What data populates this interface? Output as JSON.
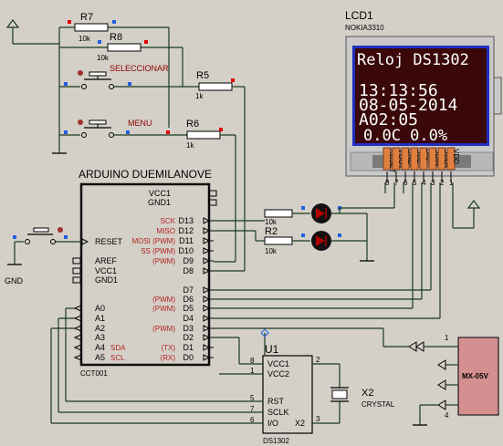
{
  "components": {
    "r7": {
      "ref": "R7",
      "value": "10k"
    },
    "r8": {
      "ref": "R8",
      "value": "10k"
    },
    "r5": {
      "ref": "R5",
      "value": "1k"
    },
    "r6": {
      "ref": "R6",
      "value": "1k"
    },
    "r1": {
      "ref": "",
      "value": "10k"
    },
    "r2": {
      "ref": "R2",
      "value": "10k"
    },
    "btn_select": "SELECCIONAR",
    "btn_menu": "MENU",
    "gnd": "GND",
    "x2": {
      "ref": "X2",
      "value": "CRYSTAL"
    },
    "u1": {
      "ref": "U1",
      "part": "DS1302"
    },
    "mx": "MX-05V"
  },
  "arduino": {
    "title": "ARDUINO DUEMILANOVE",
    "part": "CCT001",
    "left_pins": [
      "VCC1",
      "GND1",
      "RESET",
      "AREF",
      "VCC1",
      "GND1",
      "A0",
      "A1",
      "A2",
      "A3",
      "A4 SDA",
      "A5 SCL"
    ],
    "right_labels": [
      "VCC1",
      "GND1",
      "SCK",
      "MISO",
      "MOSI (PWM)",
      "SS (PWM)",
      "(PWM)",
      "",
      "",
      "(PWM)",
      "(PWM)",
      "",
      "(PWM)",
      "",
      "(TX)",
      "(RX)"
    ],
    "right_pins": [
      "",
      "",
      "D13",
      "D12",
      "D11",
      "D10",
      "D9",
      "D8",
      "D7",
      "D6",
      "D5",
      "D4",
      "D3",
      "D2",
      "D1",
      "D0"
    ]
  },
  "lcd": {
    "title": "LCD1",
    "model": "NOKIA3310",
    "line1": "Reloj DS1302",
    "line2": "13:13:56",
    "line3": "08-05-2014",
    "line4": "A02:05",
    "line5": "0.0C  0.0%",
    "pins": [
      "RESET",
      "VOUT",
      "GND",
      "SCE",
      "D/C",
      "SDIN",
      "SCLK",
      "VDD"
    ],
    "pin_numbers": [
      "8",
      "7",
      "6",
      "5",
      "4",
      "3",
      "2",
      "1"
    ]
  },
  "ds1302": {
    "pins_left": [
      "VCC1",
      "VCC2",
      "RST",
      "SCLK",
      "I/O"
    ],
    "pin_nums_left": [
      "8",
      "1",
      "5",
      "7",
      "6"
    ],
    "pin_right": "X2",
    "pin_nums_right": [
      "2",
      "3"
    ]
  },
  "module": {
    "pin_nums": [
      "1",
      "4"
    ]
  }
}
